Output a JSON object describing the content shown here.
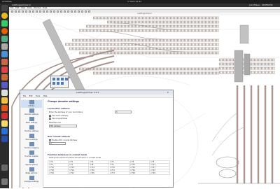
{
  "os_topbar": {
    "left": "Activities",
    "center": "1 mars 12:41",
    "right": ""
  },
  "window": {
    "title": "LokProgrammer 4",
    "right_title": "Job Phase – 0b956cf4c"
  },
  "menu": [
    "File",
    "Edit",
    "View",
    "Tools",
    "Window",
    "Help"
  ],
  "subtitle": "LokProgrammer",
  "dialog": {
    "title": "LokProgrammer 4.5.3",
    "bar_items": [
      "File",
      "Edit",
      "Tools",
      "Help"
    ],
    "heading": "Change decoder settings",
    "sidebar": [
      {
        "label": "Address"
      },
      {
        "label": "Decoder settings"
      },
      {
        "label": "Motor settings"
      },
      {
        "label": "Function settings"
      },
      {
        "label": "Sound settings"
      },
      {
        "label": "Function mapping"
      },
      {
        "label": "Function outputs"
      },
      {
        "label": "Special options"
      },
      {
        "label": "Brake sections"
      },
      {
        "label": "Analogue settings"
      }
    ],
    "sections": {
      "locomotive": "Locomotive address",
      "loco_field_label": "Enter the address of your locomotive",
      "loco_value": "3",
      "opt1": "Use short address",
      "opt2": "Use long address",
      "mfx": "Mfx/Motorola",
      "mfx_value": "Mfx address",
      "dcc": "DCC consist address",
      "dcc_label": "Enable DCC consist address",
      "dcc_value": "0",
      "fx": "Function behaviour in consist mode",
      "fx_desc": "Define here which functions should work in consist mode"
    },
    "fx_table": [
      [
        "F0",
        "F1",
        "F2",
        "F3",
        "F4",
        "F5"
      ],
      [
        "F6",
        "F7",
        "F8",
        "F9",
        "F10",
        "F11"
      ],
      [
        "F12",
        "F13",
        "F14",
        "F15",
        "F16",
        "F17"
      ],
      [
        "F18",
        "F19",
        "F20",
        "F21",
        "F22",
        "F23"
      ],
      [
        "F24",
        "F25",
        "F26",
        "F27",
        "F28",
        "F29"
      ]
    ]
  },
  "colors": {
    "track_rail": "#8c8c8c",
    "track_tie": "#b99a8c",
    "dock": "#2c2c2c"
  }
}
